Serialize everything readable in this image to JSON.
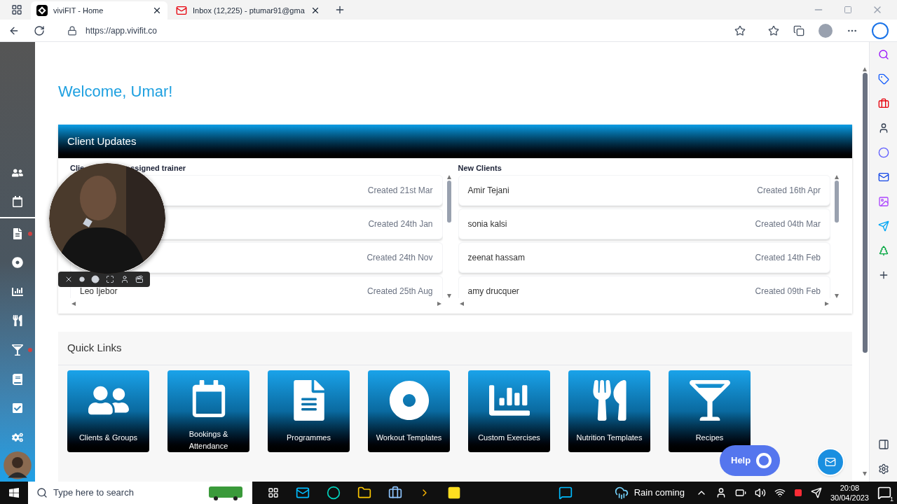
{
  "browser": {
    "tabs": [
      {
        "title": "viviFIT - Home",
        "selected": true
      },
      {
        "title": "Inbox (12,225) - ptumar91@gma",
        "selected": false
      }
    ],
    "url": "https://app.vivifit.co"
  },
  "sidebar": {
    "items": [
      {
        "alert": false
      },
      {
        "alert": false
      },
      {
        "alert": true
      },
      {
        "alert": false
      },
      {
        "alert": false
      },
      {
        "alert": false
      },
      {
        "alert": true
      },
      {
        "alert": false
      },
      {
        "alert": false
      },
      {
        "alert": false
      }
    ]
  },
  "welcome": "Welcome, Umar!",
  "client_updates": {
    "title": "Client Updates",
    "lists": [
      {
        "heading_parts": [
          "Clie",
          "ssigned trainer"
        ],
        "rows": [
          {
            "date": "Created 21st Mar"
          },
          {
            "date": "Created 24th Jan"
          },
          {
            "date": "Created 24th Nov"
          },
          {
            "name": "Leo Ijebor",
            "date": "Created 25th Aug"
          }
        ]
      },
      {
        "heading_parts": [
          "New Clients"
        ],
        "rows": [
          {
            "name": "Amir Tejani",
            "date": "Created 16th Apr"
          },
          {
            "name": "sonia kalsi",
            "date": "Created 04th Mar"
          },
          {
            "name": "zeenat hassam",
            "date": "Created 14th Feb"
          },
          {
            "name": "amy drucquer",
            "date": "Created 09th Feb"
          }
        ]
      }
    ]
  },
  "quick_links": {
    "title": "Quick Links",
    "links": [
      {
        "label": "Clients & Groups"
      },
      {
        "label": "Bookings & Attendance"
      },
      {
        "label": "Programmes"
      },
      {
        "label": "Workout Templates"
      },
      {
        "label": "Custom Exercises"
      },
      {
        "label": "Nutrition Templates"
      },
      {
        "label": "Recipes"
      }
    ]
  },
  "help": "Help",
  "taskbar": {
    "search_placeholder": "Type here to search",
    "weather": "Rain coming",
    "time": "20:08",
    "date": "30/04/2023",
    "notifications": "1"
  }
}
